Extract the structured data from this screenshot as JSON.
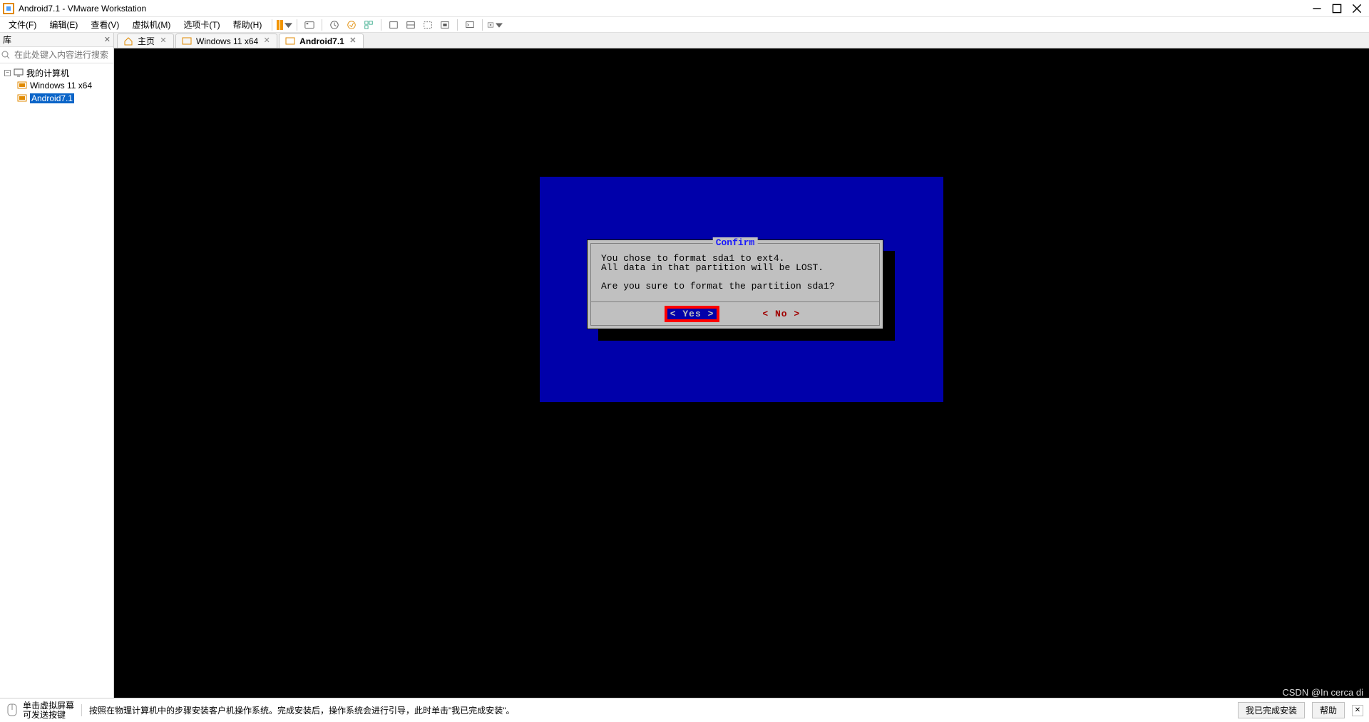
{
  "window": {
    "title": "Android7.1 - VMware Workstation"
  },
  "menu": {
    "file": "文件(F)",
    "edit": "编辑(E)",
    "view": "查看(V)",
    "vm": "虚拟机(M)",
    "tabs": "选项卡(T)",
    "help": "帮助(H)"
  },
  "sidebar": {
    "title": "库",
    "search_placeholder": "在此处键入内容进行搜索",
    "root": "我的计算机",
    "items": [
      {
        "label": "Windows 11 x64",
        "selected": false
      },
      {
        "label": "Android7.1",
        "selected": true
      }
    ]
  },
  "tabs": [
    {
      "label": "主页",
      "active": false,
      "kind": "home"
    },
    {
      "label": "Windows 11 x64",
      "active": false,
      "kind": "vm"
    },
    {
      "label": "Android7.1",
      "active": true,
      "kind": "vm"
    }
  ],
  "dialog": {
    "title": "Confirm",
    "line1": "You chose to format sda1 to ext4.",
    "line2": "All data in that partition will be LOST.",
    "line3": "Are you sure to format the partition sda1?",
    "yes": "< Yes >",
    "no": "<  No  >"
  },
  "status": {
    "tip_line1": "单击虚拟屏幕",
    "tip_line2": "可发送按键",
    "message": "按照在物理计算机中的步骤安装客户机操作系统。完成安装后，操作系统会进行引导，此时单击\"我已完成安装\"。",
    "btn_done": "我已完成安装",
    "btn_help": "帮助"
  },
  "watermark": "CSDN @In cerca di"
}
